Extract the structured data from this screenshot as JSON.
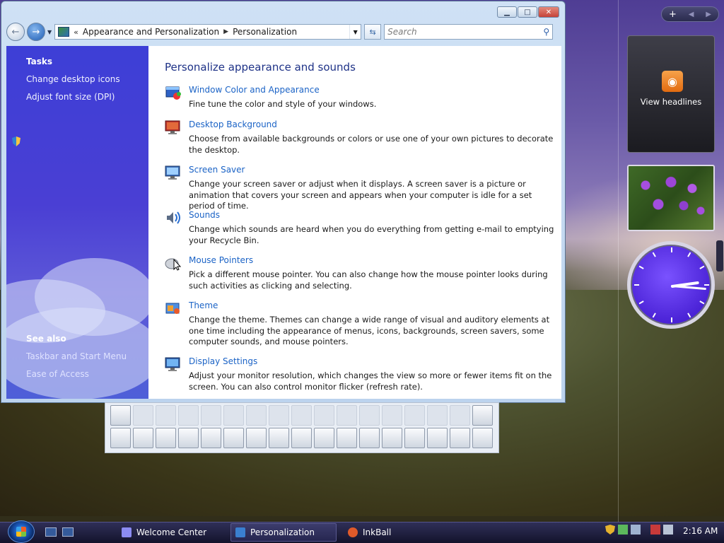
{
  "window": {
    "breadcrumb": [
      "«",
      "Appearance and Personalization",
      "Personalization"
    ],
    "search_placeholder": "Search",
    "controls": [
      "minimize",
      "maximize",
      "close"
    ]
  },
  "left_pane": {
    "tasks_heading": "Tasks",
    "tasks": [
      "Change desktop icons",
      "Adjust font size (DPI)"
    ],
    "see_also_heading": "See also",
    "see_also": [
      "Taskbar and Start Menu",
      "Ease of Access"
    ]
  },
  "content": {
    "heading": "Personalize appearance and sounds",
    "items": [
      {
        "title": "Window Color and Appearance",
        "desc": "Fine tune the color and style of your windows.",
        "icon": "window-color-icon"
      },
      {
        "title": "Desktop Background",
        "desc": "Choose from available backgrounds or colors or use one of your own pictures to decorate the desktop.",
        "icon": "desktop-background-icon"
      },
      {
        "title": "Screen Saver",
        "desc": "Change your screen saver or adjust when it displays. A screen saver is a picture or animation that covers your screen and appears when your computer is idle for a set period of time.",
        "icon": "screen-saver-icon"
      },
      {
        "title": "Sounds",
        "desc": "Change which sounds are heard when you do everything from getting e-mail to emptying your Recycle Bin.",
        "icon": "sounds-icon"
      },
      {
        "title": "Mouse Pointers",
        "desc": "Pick a different mouse pointer. You can also change how the mouse pointer looks during such activities as clicking and selecting.",
        "icon": "mouse-pointer-icon"
      },
      {
        "title": "Theme",
        "desc": "Change the theme. Themes can change a wide range of visual and auditory elements at one time including the appearance of menus, icons, backgrounds, screen savers, some computer sounds, and mouse pointers.",
        "icon": "theme-icon"
      },
      {
        "title": "Display Settings",
        "desc": "Adjust your monitor resolution, which changes the view so more or fewer items fit on the screen. You can also control monitor flicker (refresh rate).",
        "icon": "display-settings-icon"
      }
    ]
  },
  "sidebar": {
    "add_gadget": "+",
    "feed_label": "View headlines"
  },
  "taskbar": {
    "tasks": [
      {
        "label": "Welcome Center",
        "active": false
      },
      {
        "label": "Personalization",
        "active": true
      },
      {
        "label": "InkBall",
        "active": false
      }
    ],
    "time": "2:16 AM"
  },
  "colors": {
    "link": "#1b63c6",
    "heading": "#1e3287",
    "left_pane": "#4a3fd4",
    "clock_face": "#5a2ff0"
  }
}
